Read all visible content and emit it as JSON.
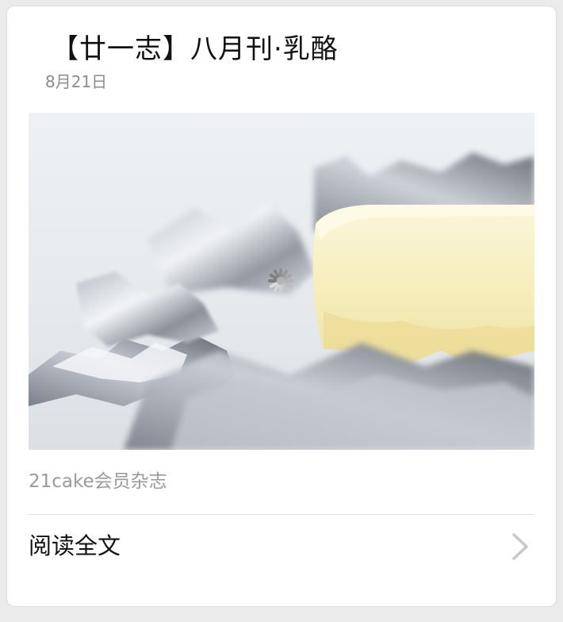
{
  "article": {
    "title": "【廿一志】八月刊·乳酪",
    "date": "8月21日",
    "source": "21cake会员杂志",
    "read_more_label": "阅读全文"
  },
  "cover_image": {
    "subject": "cheesecake-slice-on-foil",
    "loading": true
  },
  "icons": {
    "loading_spinner": "spinner-icon",
    "read_more_arrow": "chevron-right-icon"
  },
  "colors": {
    "background": "#ebebeb",
    "card": "#ffffff",
    "title_text": "#111111",
    "meta_text": "#8c8c8c",
    "chevron": "#c7c7cc"
  }
}
